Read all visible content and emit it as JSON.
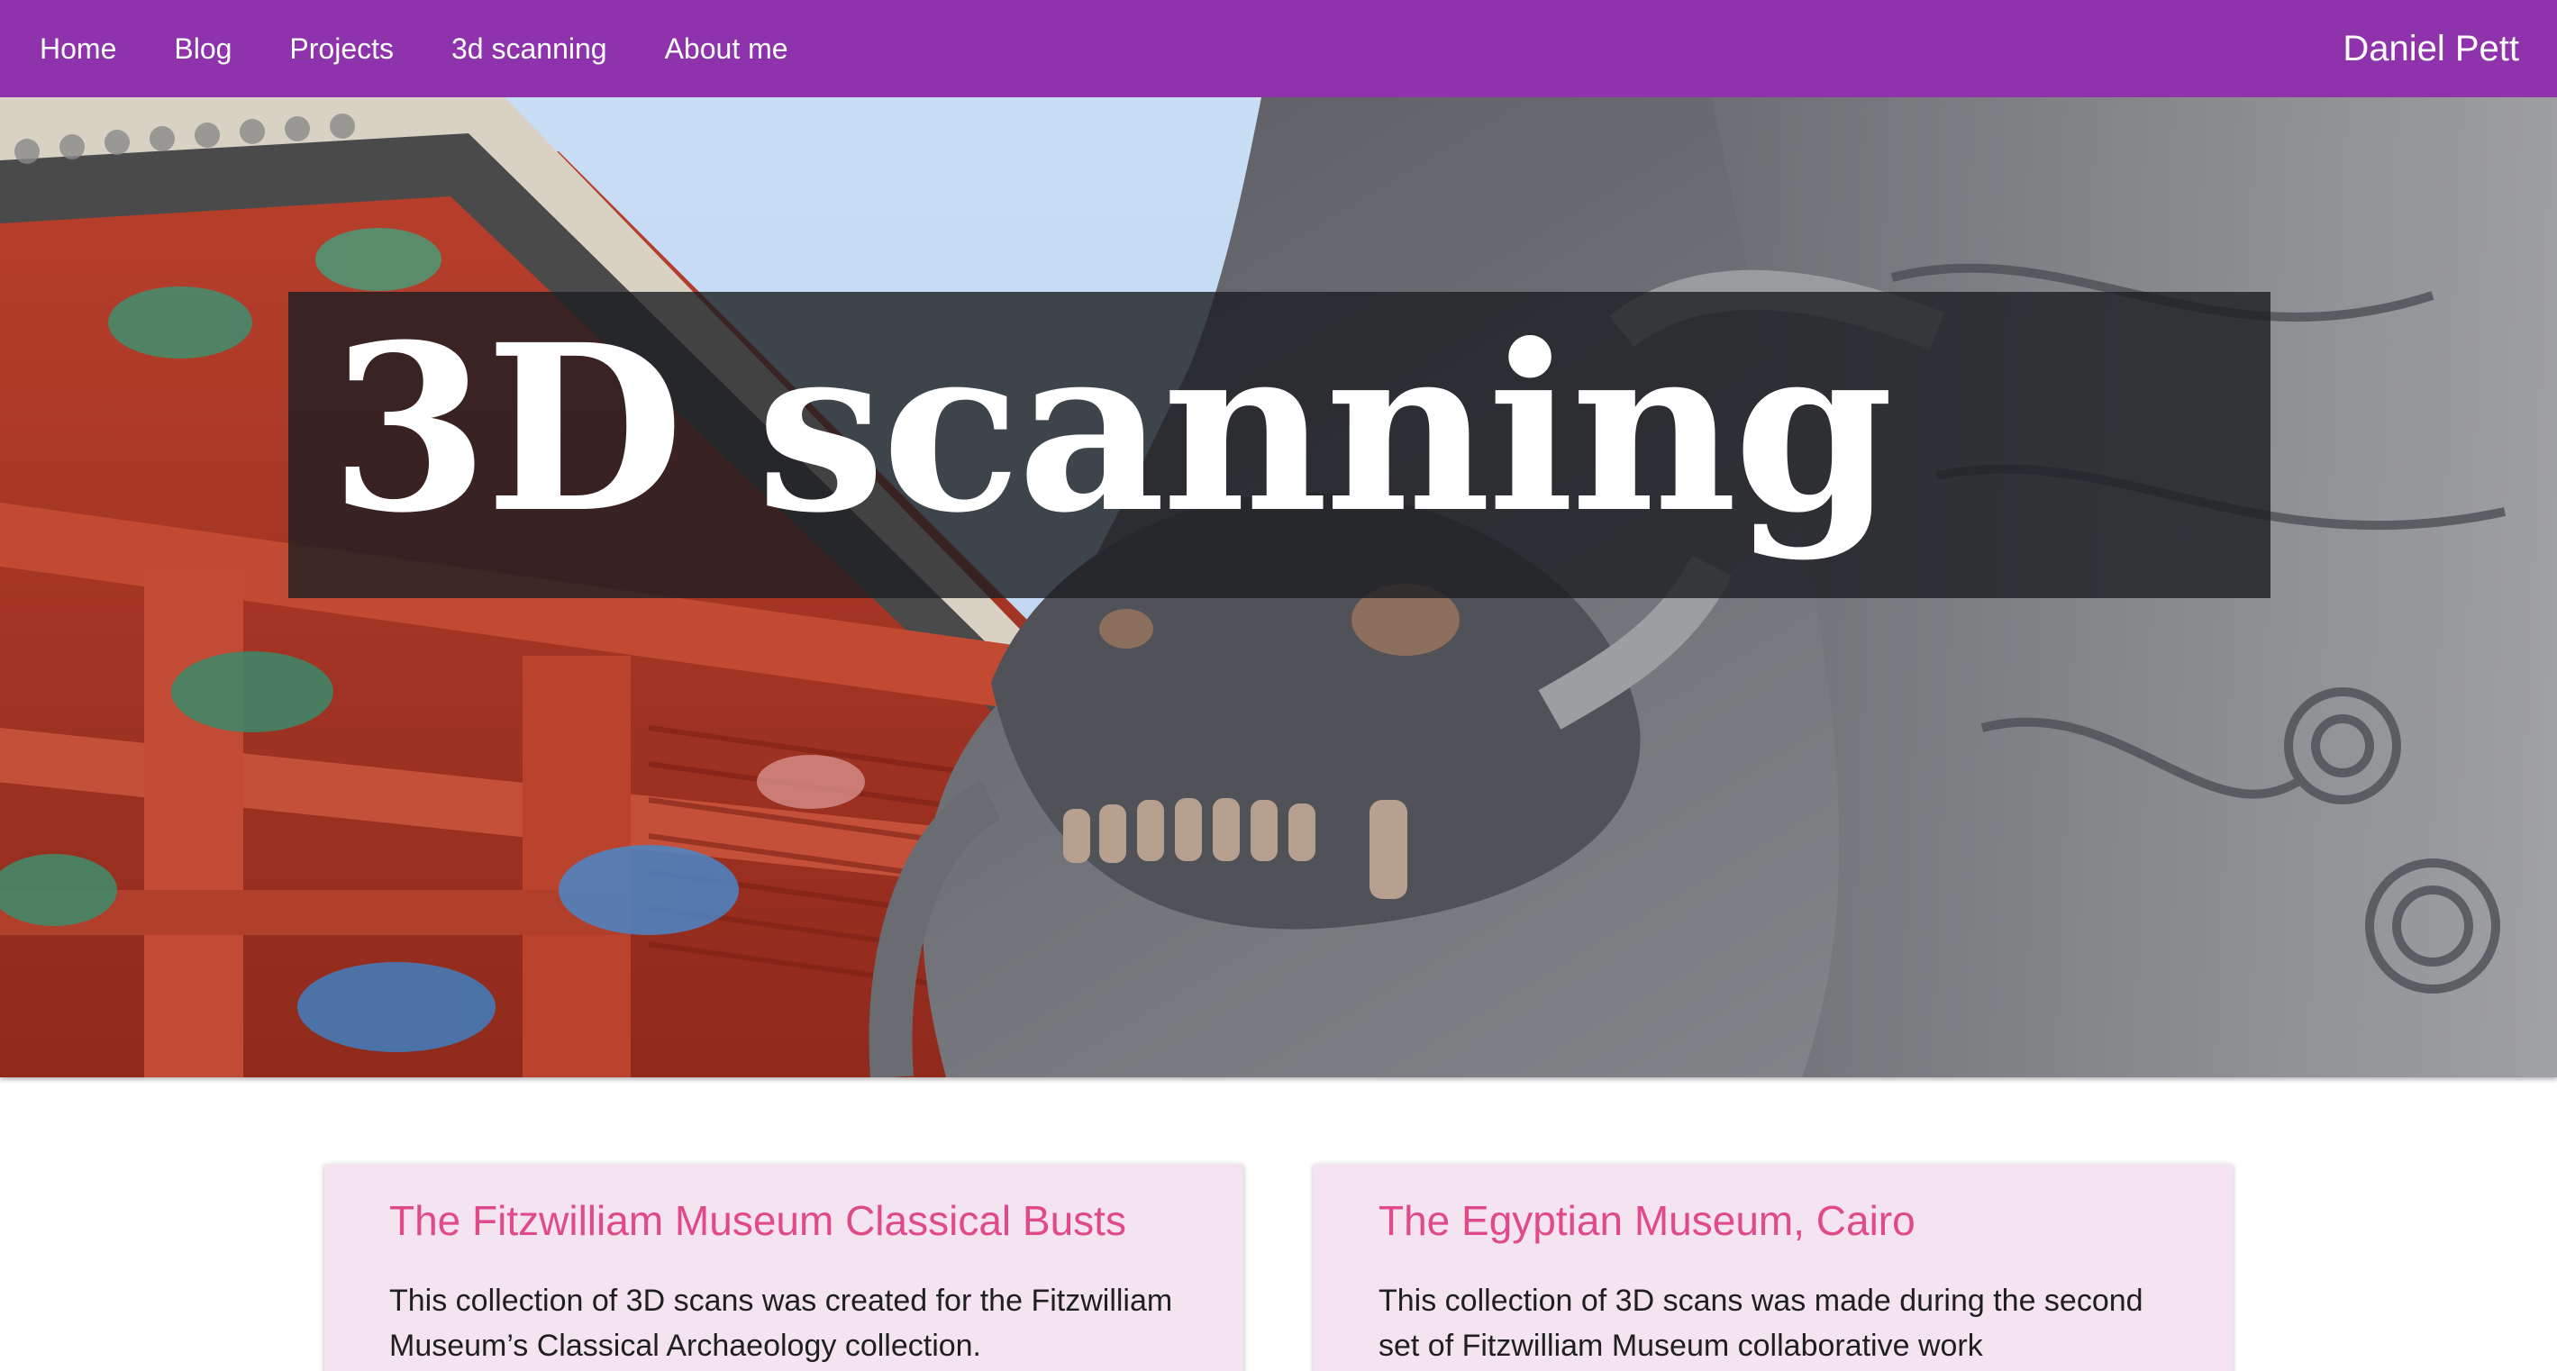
{
  "nav": {
    "links": [
      {
        "label": "Home"
      },
      {
        "label": "Blog"
      },
      {
        "label": "Projects"
      },
      {
        "label": "3d scanning"
      },
      {
        "label": "About me"
      }
    ],
    "brand": "Daniel Pett"
  },
  "hero": {
    "title": "3D scanning"
  },
  "cards": [
    {
      "title": "The Fitzwilliam Museum Classical Busts",
      "text": "This collection of 3D scans was created for the Fitzwilliam Museum’s Classical Archaeology collection."
    },
    {
      "title": "The Egyptian Museum, Cairo",
      "text": "This collection of 3D scans was made during the second set of Fitzwilliam Museum collaborative work"
    }
  ],
  "colors": {
    "navbar": "#8e33ab",
    "card_bg": "#f3e4f0",
    "card_title": "#e04a8a",
    "title_box": "#1c1e22"
  }
}
